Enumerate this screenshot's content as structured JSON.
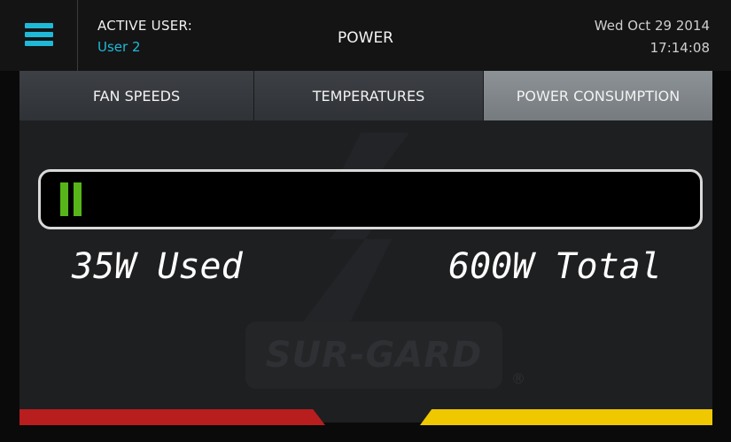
{
  "header": {
    "active_user_label": "ACTIVE USER:",
    "active_user_name": "User 2",
    "title": "POWER",
    "date": "Wed Oct 29 2014",
    "time": "17:14:08",
    "menu_icon": "hamburger-menu-icon",
    "accent_color": "#1fb9d8"
  },
  "tabs": [
    {
      "label": "FAN SPEEDS",
      "active": false
    },
    {
      "label": "TEMPERATURES",
      "active": false
    },
    {
      "label": "POWER CONSUMPTION",
      "active": true
    }
  ],
  "power": {
    "used_label": "35W Used",
    "total_label": "600W Total",
    "used_watts": 35,
    "total_watts": 600,
    "bar_color": "#57b519"
  },
  "watermark": {
    "logo_text": "SUR-GARD",
    "registered_mark": "®"
  },
  "status_strips": {
    "left_color": "#b81e1e",
    "right_color": "#f0c800"
  }
}
